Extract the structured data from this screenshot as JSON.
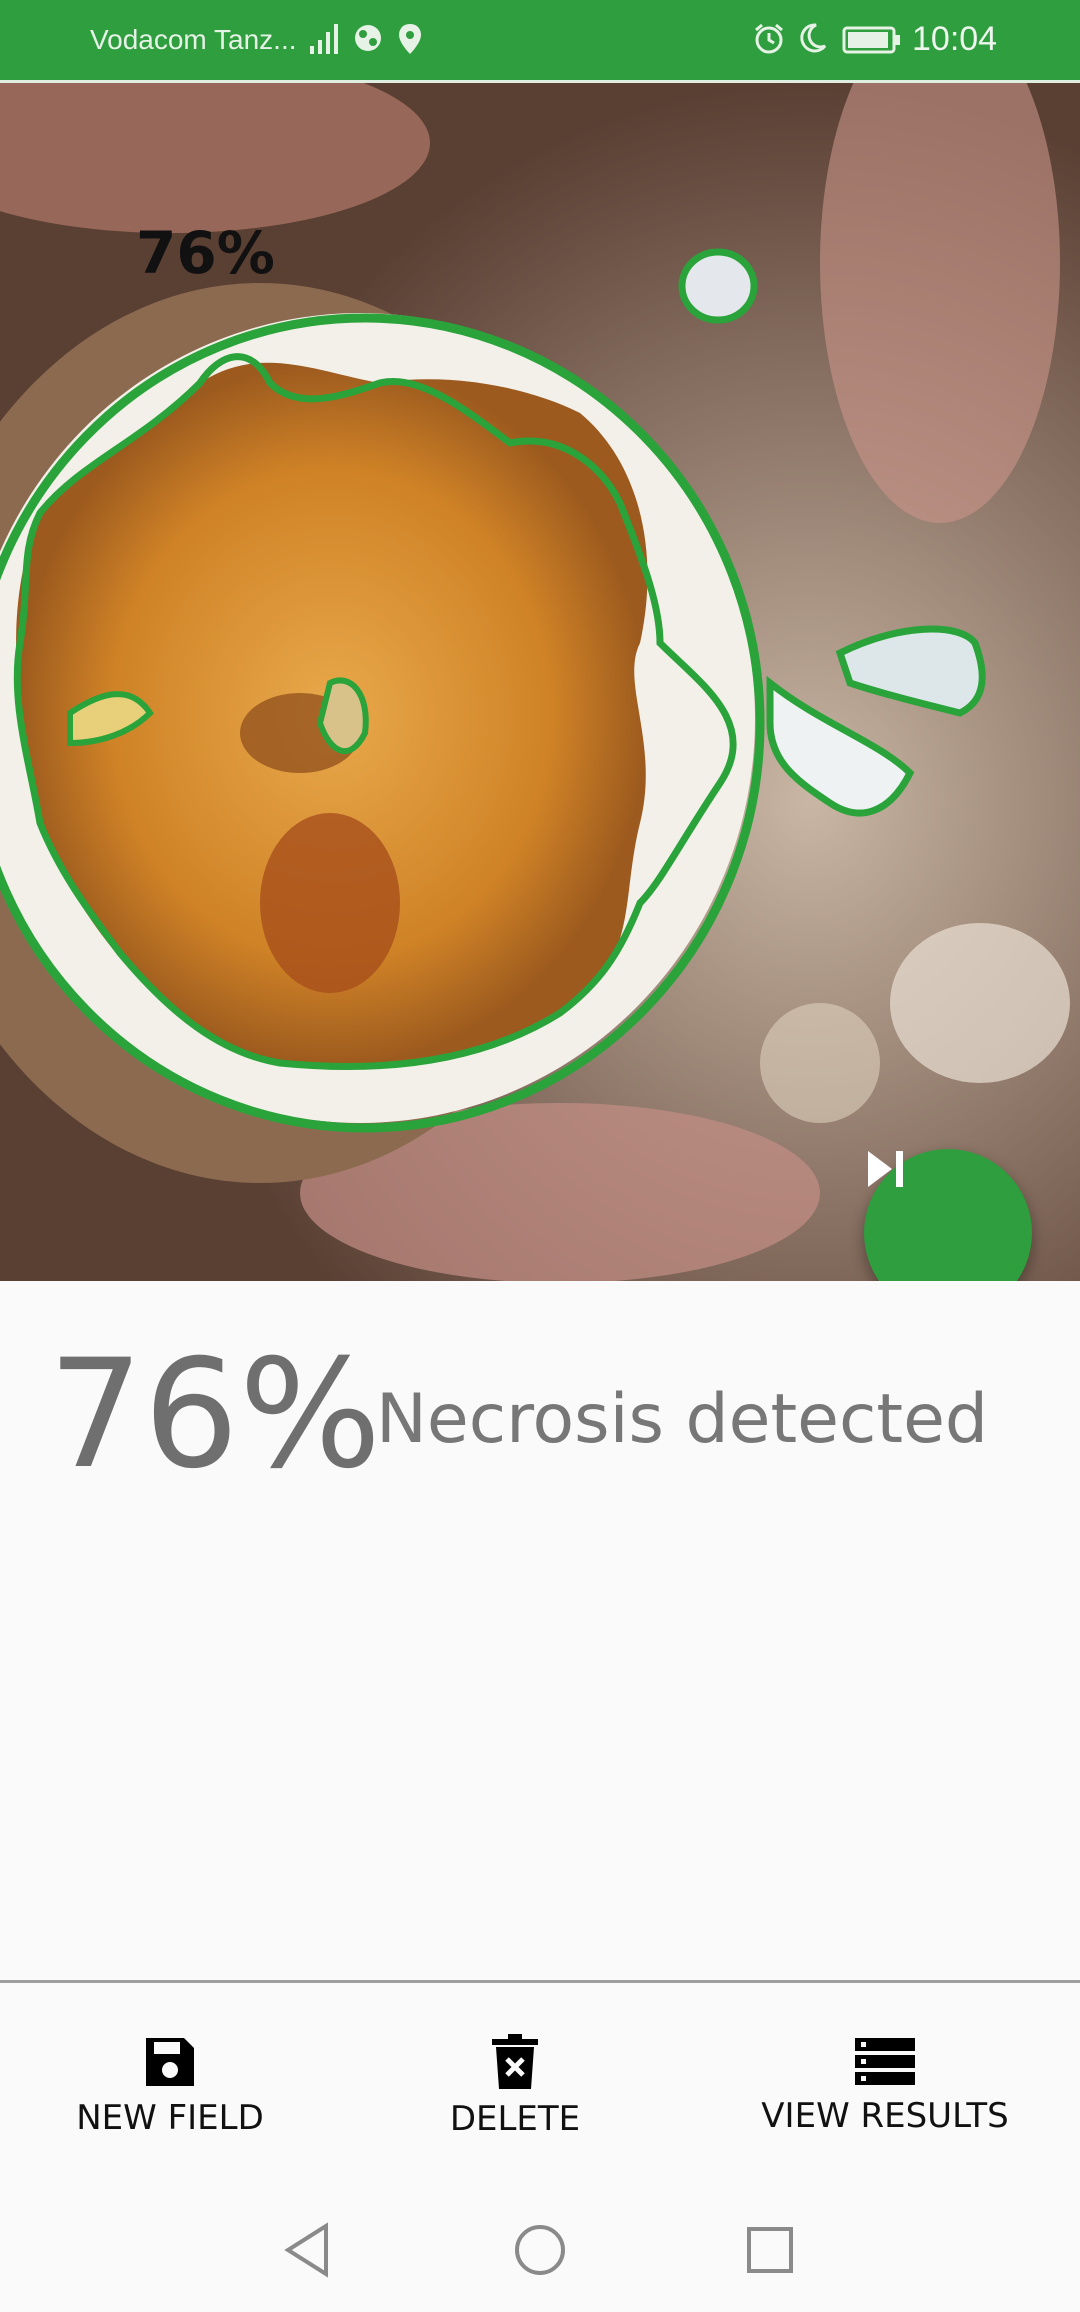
{
  "status_bar": {
    "carrier": "Vodacom Tanz...",
    "time": "10:04",
    "icons": [
      "signal-icon",
      "globe-icon",
      "location-pin-icon",
      "alarm-icon",
      "do-not-disturb-moon-icon",
      "battery-icon"
    ]
  },
  "photo": {
    "overlay_percentage": "76%",
    "fab_icon": "skip-next-icon"
  },
  "result": {
    "percentage": "76%",
    "label": "Necrosis detected"
  },
  "actions": [
    {
      "label": "NEW FIELD",
      "icon": "save-icon"
    },
    {
      "label": "DELETE",
      "icon": "trash-icon"
    },
    {
      "label": "VIEW RESULTS",
      "icon": "list-icon"
    }
  ],
  "nav": {
    "icons": [
      "back-icon",
      "home-icon",
      "recents-icon"
    ]
  },
  "colors": {
    "accent": "#2e9e3e",
    "contour": "#2aa33a",
    "necrosis": "#c8791e"
  }
}
